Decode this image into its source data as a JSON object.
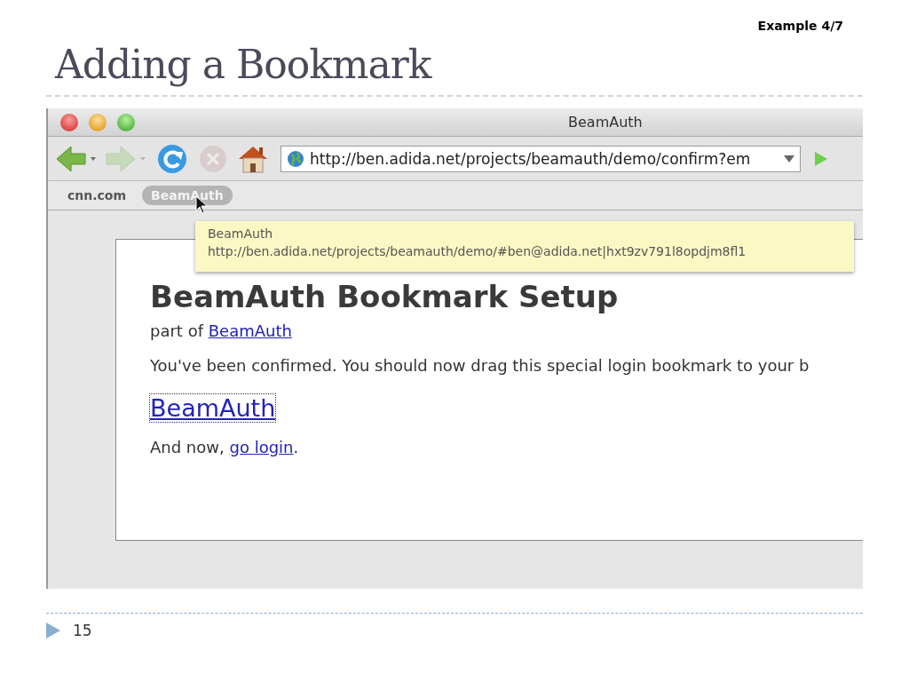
{
  "slide": {
    "tag": "Example 4/7",
    "title": "Adding a Bookmark",
    "page_number": "15"
  },
  "browser": {
    "window_title": "BeamAuth",
    "nav_buttons": [
      {
        "kind": "back",
        "disabled": false
      },
      {
        "kind": "forward",
        "disabled": true
      },
      {
        "kind": "reload",
        "disabled": false
      },
      {
        "kind": "stop",
        "disabled": true
      },
      {
        "kind": "home",
        "disabled": false
      }
    ],
    "address": "http://ben.adida.net/projects/beamauth/demo/confirm?em",
    "bookmarks": [
      {
        "label": "cnn.com",
        "selected": false
      },
      {
        "label": "BeamAuth",
        "selected": true
      }
    ],
    "tooltip": {
      "title": "BeamAuth",
      "url": "http://ben.adida.net/projects/beamauth/demo/#ben@adida.net|hxt9zv791l8opdjm8fl1"
    },
    "page": {
      "heading": "BeamAuth Bookmark Setup",
      "subtitle": "part of ",
      "subtitle_link": "BeamAuth",
      "message": "You've been confirmed. You should now drag this special login bookmark to your b",
      "bookmark_link": "BeamAuth",
      "closing": "And now, ",
      "closing_link": "go login",
      "closing_end": "."
    }
  }
}
